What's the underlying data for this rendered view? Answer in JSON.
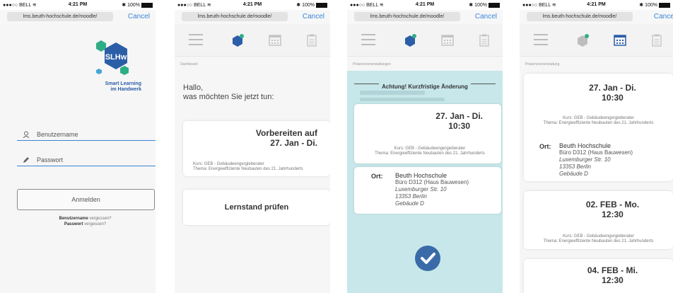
{
  "status": {
    "carrier": "●●●○○ BELL",
    "wifi": "≋",
    "time": "4:21 PM",
    "battery": "100%",
    "bluetooth": "✱"
  },
  "browser": {
    "url": "lms.beuth-hochschule.de/moodle/",
    "cancel": "Cancel"
  },
  "colors": {
    "accent": "#3a86d8",
    "hex_dark": "#2c5ea8",
    "hex_green": "#2fae86",
    "teal_bg": "#c7e7ea",
    "check": "#3a6ba8"
  },
  "login": {
    "logo_text": "SLHw",
    "logo_subtitle": [
      "Smart Learning",
      "im Handwerk"
    ],
    "username_placeholder": "Benutzername",
    "password_placeholder": "Passwort",
    "submit": "Anmelden",
    "forgot_user_bold": "Benutzername",
    "forgot_user_rest": " vergessen?",
    "forgot_pass_bold": "Passwort",
    "forgot_pass_rest": " vergessen?"
  },
  "dashboard": {
    "crumb": "Dashboard",
    "greeting_1": "Hallo,",
    "greeting_2": "was möchten Sie jetzt tun:",
    "card1_title_1": "Vorbereiten auf",
    "card1_title_2": "27. Jan - Di.",
    "card1_kurs": "Kurs: GEB - Gebäudeengergieberater",
    "card1_thema": "Thema: Energieeffiziente Neubauten des 21. Jahrhunderts",
    "card2_title": "Lernstand prüfen"
  },
  "change": {
    "crumb": "Präsenzveranstaltungen",
    "banner": "Achtung! Kurzfristige Änderung",
    "date_1": "27. Jan - Di.",
    "date_2": "10:30",
    "kurs": "Kurs: GEB - Gebäudeengergieberater",
    "thema": "Thema: Energieeffiziente Neubauten des 21. Jahrhunderts",
    "ort_label": "Ort:",
    "ort_lines": [
      "Beuth Hochschule",
      "Büro D312 (Haus Bauwesen)",
      "Luxemburger Str. 10",
      "13353 Berlin",
      "Gebäude D"
    ]
  },
  "events": {
    "crumb": "Präsenzveranstaltung",
    "e1_date_1": "27. Jan - Di.",
    "e1_date_2": "10:30",
    "e1_kurs": "Kurs: GEB - Gebäudeengergieberater",
    "e1_thema": "Thema: Energieeffiziente Neubauten des 21. Jahrhunderts",
    "e1_ort_label": "Ort:",
    "e1_ort_lines": [
      "Beuth Hochschule",
      "Büro D312 (Haus Bauwesen)",
      "Luxemburger Str. 10",
      "13353 Berlin",
      "Gebäude D"
    ],
    "e2_date_1": "02. FEB - Mo.",
    "e2_date_2": "12:30",
    "e2_kurs": "Kurs: GEB - Gebäudeengergieberater",
    "e2_thema": "Thema: Energieeffiziente Neubauten des 21. Jahrhunderts",
    "e3_date_1": "04. FEB - Mi.",
    "e3_date_2": "12:30"
  }
}
